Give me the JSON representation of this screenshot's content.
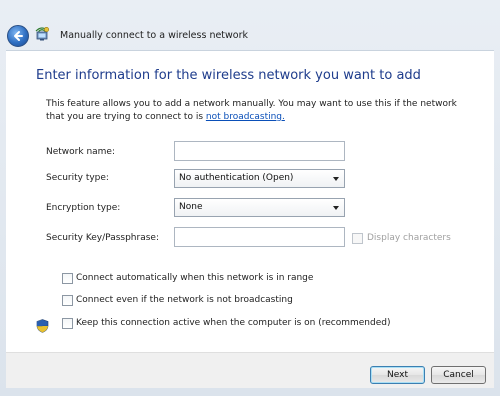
{
  "window": {
    "title": "Manually connect to a wireless network"
  },
  "main": {
    "heading": "Enter information for the wireless network you want to add",
    "description_before_link": "This feature allows you to add a network manually. You may want to use this if the network that you are trying to connect to is ",
    "description_link": "not broadcasting."
  },
  "form": {
    "network_name": {
      "label": "Network name:",
      "value": ""
    },
    "security_type": {
      "label": "Security type:",
      "value": "No authentication (Open)"
    },
    "encryption_type": {
      "label": "Encryption type:",
      "value": "None"
    },
    "security_key": {
      "label": "Security Key/Passphrase:",
      "value": ""
    },
    "display_characters": {
      "label": "Display characters",
      "checked": false,
      "enabled": false
    }
  },
  "options": [
    {
      "label": "Connect automatically when this network is in range",
      "checked": false
    },
    {
      "label": "Connect even if the network is not broadcasting",
      "checked": false
    },
    {
      "label": "Keep this connection active when the computer is on (recommended)",
      "checked": false
    }
  ],
  "footer": {
    "next_label": "Next",
    "cancel_label": "Cancel"
  },
  "icons": {
    "back": "back-arrow-icon",
    "network": "wireless-network-icon",
    "shield": "uac-shield-icon"
  },
  "colors": {
    "heading": "#1e3c8c",
    "link": "#0a4fb8",
    "frame": "#dbe3ec"
  }
}
